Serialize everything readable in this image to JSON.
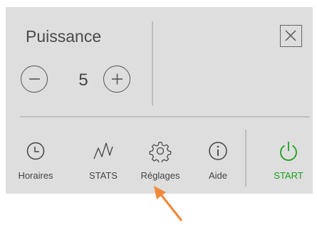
{
  "panel": {
    "title": "Puissance",
    "power_value": "5",
    "minus_symbol": "−",
    "plus_symbol": "+"
  },
  "nav": {
    "items": [
      {
        "label": "Horaires",
        "icon": "clock-icon"
      },
      {
        "label": "STATS",
        "icon": "stats-wave-icon"
      },
      {
        "label": "Réglages",
        "icon": "gear-icon"
      },
      {
        "label": "Aide",
        "icon": "info-icon"
      },
      {
        "label": "START",
        "icon": "power-icon"
      }
    ]
  },
  "colors": {
    "panel_bg": "#dedede",
    "text": "#444444",
    "start_green": "#1aa21a",
    "arrow_orange": "#f08a3c"
  },
  "annotation": {
    "pointer_icon": "orange-arrow-icon"
  }
}
